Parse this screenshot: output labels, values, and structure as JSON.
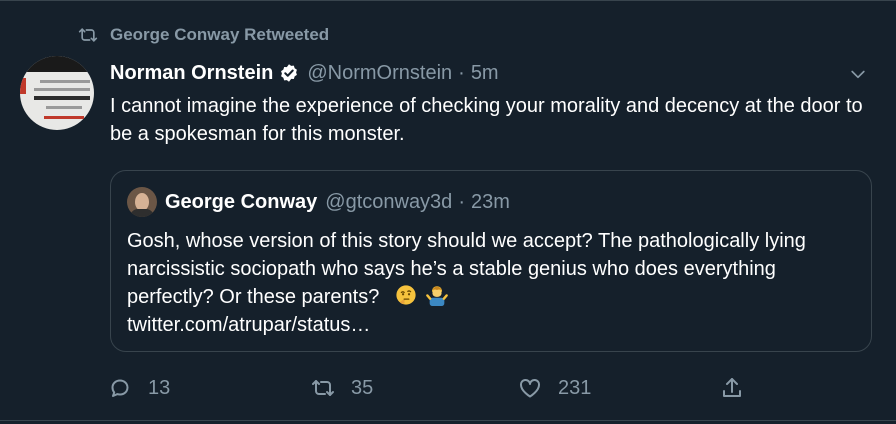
{
  "retweet": {
    "icon": "retweet-icon",
    "label": "George Conway Retweeted"
  },
  "tweet": {
    "author_name": "Norman Ornstein",
    "verified_icon": "verified-badge-icon",
    "handle": "@NormOrnstein",
    "separator": "·",
    "time": "5m",
    "text": "I cannot imagine the experience of checking your morality and decency at the door to be a spokesman for this monster."
  },
  "quoted_tweet": {
    "author_name": "George Conway",
    "handle": "@gtconway3d",
    "separator": "·",
    "time": "23m",
    "text": "Gosh, whose version of this story should we accept?  The pathologically lying narcissistic sociopath who says he’s a stable genius who does everything perfectly? Or these parents?",
    "emojis": [
      "thinking-face-emoji",
      "man-shrugging-emoji"
    ],
    "link": "twitter.com/atrupar/status…"
  },
  "actions": {
    "reply_count": "13",
    "retweet_count": "35",
    "like_count": "231",
    "share_icon": "share-icon"
  },
  "colors": {
    "background": "#15202b",
    "border": "#38444d",
    "text_primary": "#ffffff",
    "text_secondary": "#8899a6",
    "verified_badge": "#ffffff"
  }
}
